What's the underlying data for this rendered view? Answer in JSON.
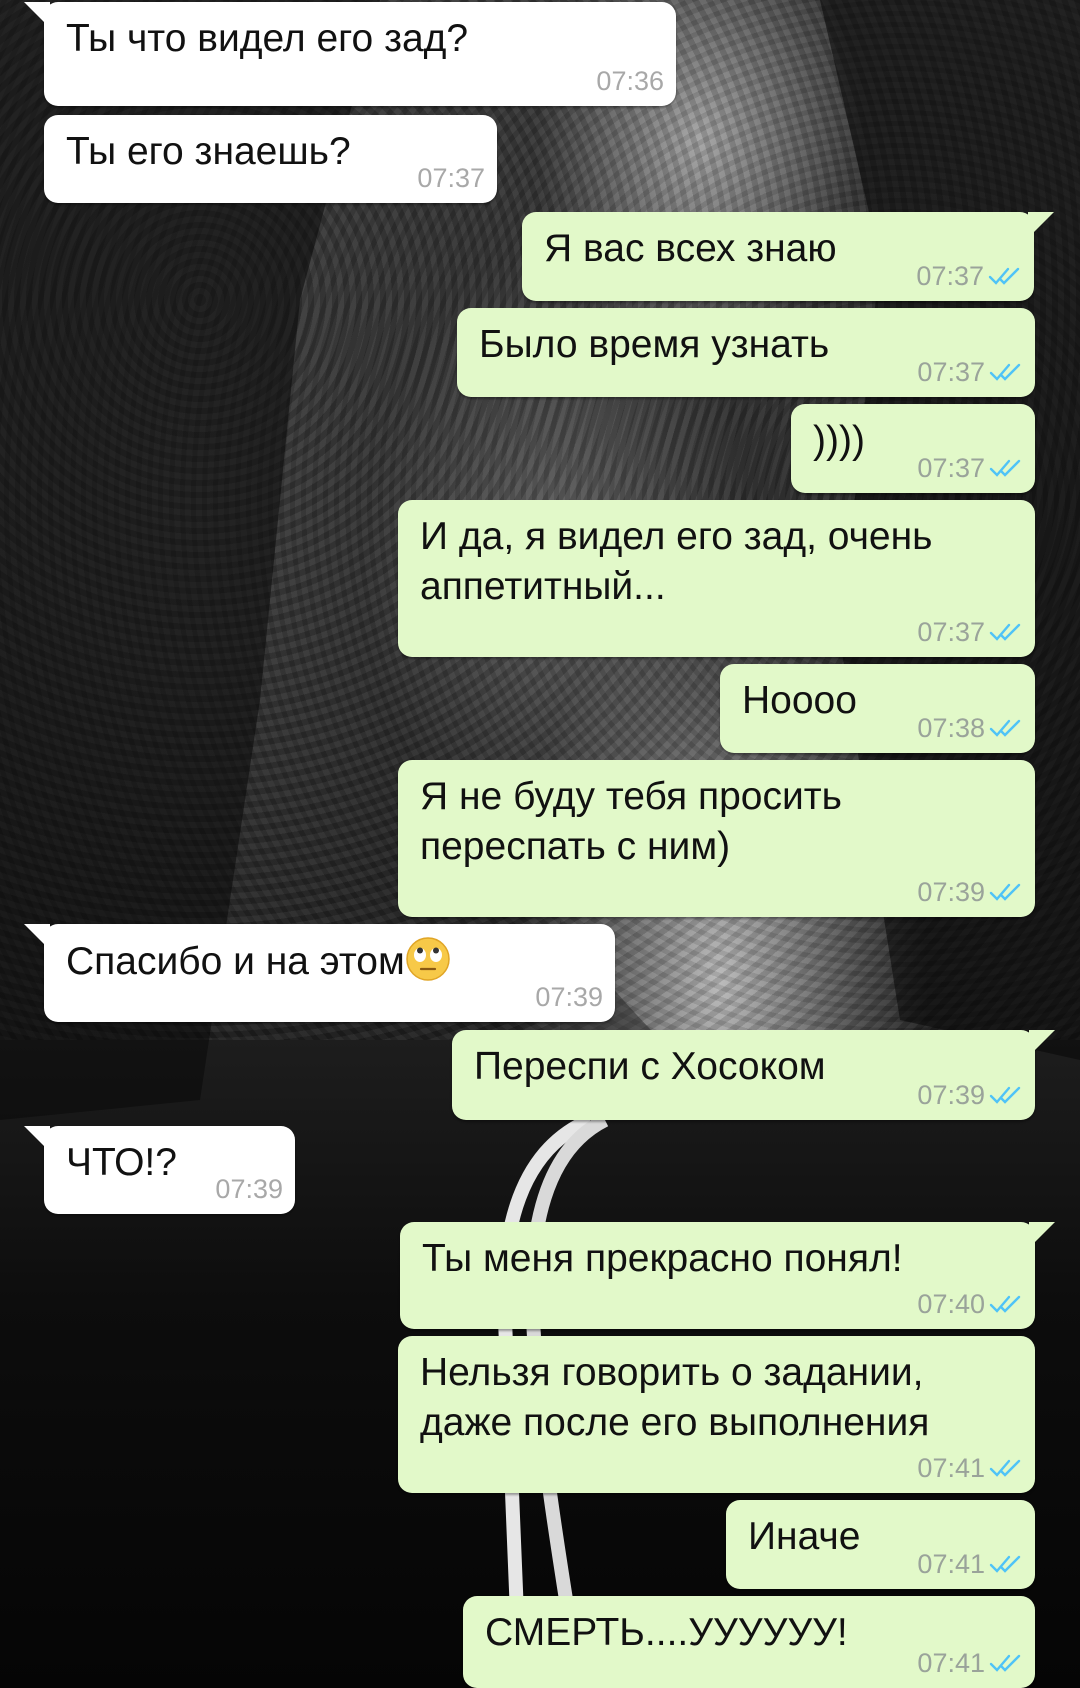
{
  "colors": {
    "incoming_bubble": "#ffffff",
    "outgoing_bubble": "#e2f9c9",
    "read_ticks": "#4fc3f7",
    "timestamp": "#9aa39a"
  },
  "messages": [
    {
      "direction": "incoming",
      "lines": [
        "Ты что видел его зад?"
      ],
      "time": "07:36"
    },
    {
      "direction": "incoming",
      "lines": [
        "Ты его знаешь?"
      ],
      "time": "07:37"
    },
    {
      "direction": "outgoing",
      "lines": [
        "Я вас всех знаю"
      ],
      "time": "07:37",
      "status": "read-ticks-icon"
    },
    {
      "direction": "outgoing",
      "lines": [
        "Было время узнать"
      ],
      "time": "07:37",
      "status": "read-ticks-icon"
    },
    {
      "direction": "outgoing",
      "lines": [
        "))))"
      ],
      "time": "07:37",
      "status": "read-ticks-icon"
    },
    {
      "direction": "outgoing",
      "lines": [
        "И да, я видел его зад, очень",
        "аппетитный..."
      ],
      "time": "07:37",
      "status": "read-ticks-icon"
    },
    {
      "direction": "outgoing",
      "lines": [
        "Нoooo"
      ],
      "time": "07:38",
      "status": "read-ticks-icon"
    },
    {
      "direction": "outgoing",
      "lines": [
        "Я не буду тебя просить",
        "переспать с ним)"
      ],
      "time": "07:39",
      "status": "read-ticks-icon"
    },
    {
      "direction": "incoming",
      "lines": [
        "Спасибо и на этом"
      ],
      "emoji": "eye-roll-emoji-icon",
      "time": "07:39"
    },
    {
      "direction": "outgoing",
      "lines": [
        "Переспи с Хосоком"
      ],
      "time": "07:39",
      "status": "read-ticks-icon"
    },
    {
      "direction": "incoming",
      "lines": [
        "ЧТО!?"
      ],
      "time": "07:39"
    },
    {
      "direction": "outgoing",
      "lines": [
        "Ты меня прекрасно понял!"
      ],
      "time": "07:40",
      "status": "read-ticks-icon"
    },
    {
      "direction": "outgoing",
      "lines": [
        "Нельзя говорить о задании,",
        "даже после его выполнения"
      ],
      "time": "07:41",
      "status": "read-ticks-icon"
    },
    {
      "direction": "outgoing",
      "lines": [
        "Иначе"
      ],
      "time": "07:41",
      "status": "read-ticks-icon"
    },
    {
      "direction": "outgoing",
      "lines": [
        "СМЕРТЬ....УУУУУУ!"
      ],
      "time": "07:41",
      "status": "read-ticks-icon"
    }
  ]
}
